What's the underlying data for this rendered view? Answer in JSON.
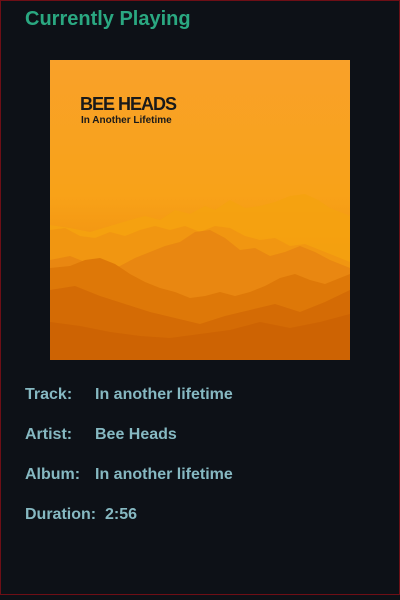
{
  "header": {
    "title": "Currently Playing"
  },
  "album_art": {
    "band_name": "BEE HEADS",
    "album_title": "In Another Lifetime"
  },
  "track_info": {
    "track_label": "Track:",
    "track_value": "In another lifetime",
    "artist_label": "Artist:",
    "artist_value": "Bee Heads",
    "album_label": "Album:",
    "album_value": "In another lifetime",
    "duration_label": "Duration:",
    "duration_value": "2:56"
  },
  "colors": {
    "background": "#0d1117",
    "title": "#2aa881",
    "info_text": "#86b9c2",
    "border": "#6e0f16"
  }
}
